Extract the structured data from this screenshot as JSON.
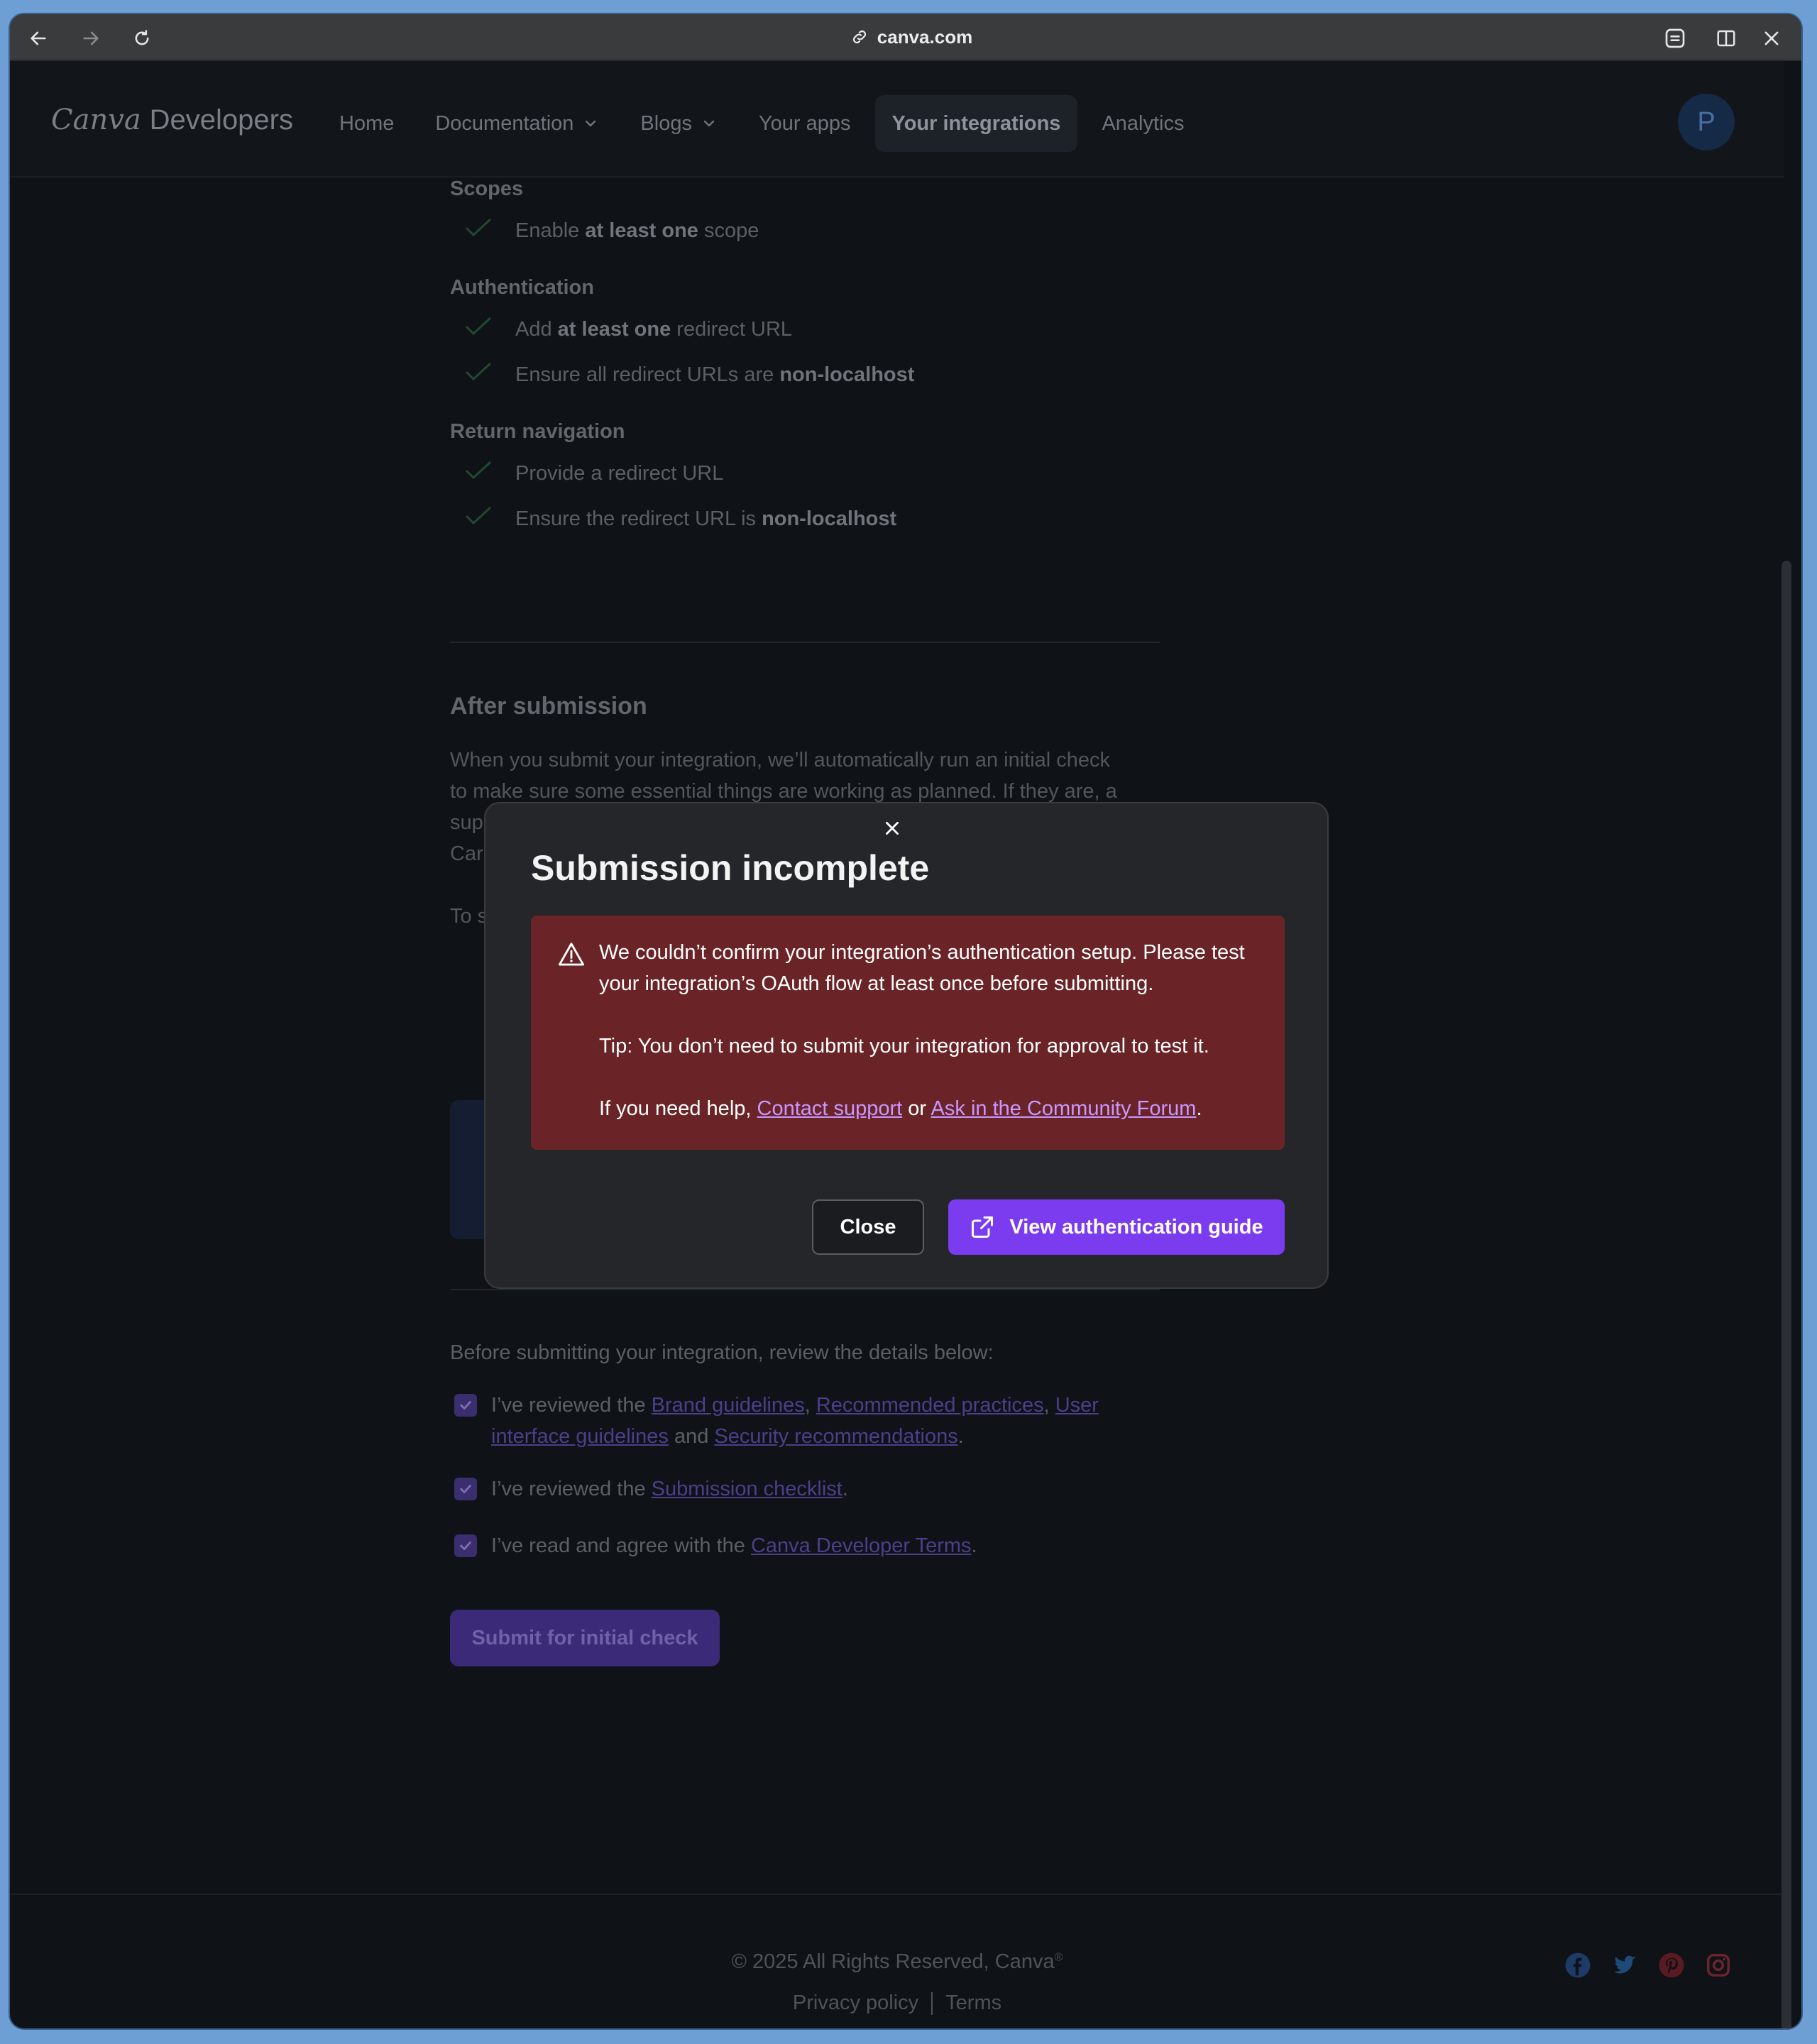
{
  "browser": {
    "url": "canva.com"
  },
  "header": {
    "logo_script": "Canva",
    "logo_text": "Developers",
    "nav": [
      {
        "label": "Home"
      },
      {
        "label": "Documentation"
      },
      {
        "label": "Blogs"
      },
      {
        "label": "Your apps"
      },
      {
        "label": "Your integrations"
      },
      {
        "label": "Analytics"
      }
    ],
    "avatar_initial": "P"
  },
  "checklist": {
    "scopes_title": "Scopes",
    "scopes_item_pre": "Enable ",
    "scopes_item_bold": "at least one",
    "scopes_item_post": " scope",
    "auth_title": "Authentication",
    "auth_item1_pre": "Add ",
    "auth_item1_bold": "at least one",
    "auth_item1_post": " redirect URL",
    "auth_item2_pre": "Ensure all redirect URLs are ",
    "auth_item2_bold": "non-localhost",
    "return_title": "Return navigation",
    "return_item1": "Provide a redirect URL",
    "return_item2_pre": "Ensure the redirect URL is ",
    "return_item2_bold": "non-localhost"
  },
  "after": {
    "title": "After submission",
    "para_line1": "When you submit your integration, we’ll automatically run an initial check",
    "para_line2": "to make sure some essential things are working as planned. If they are, a",
    "para_line3": "sup",
    "para_line4": "Car",
    "para_line5": "To s"
  },
  "review": {
    "intro": "Before submitting your integration, review the details below:",
    "item1_pre": "I’ve reviewed the ",
    "item1_link1": "Brand guidelines",
    "item1_sep1": ", ",
    "item1_link2": "Recommended practices",
    "item1_sep2": ", ",
    "item1_link3a": "User",
    "item1_link3b": "interface guidelines",
    "item1_and": " and ",
    "item1_link4": "Security recommendations",
    "item1_end": ".",
    "item2_pre": "I’ve reviewed the ",
    "item2_link": "Submission checklist",
    "item2_end": ".",
    "item3_pre": "I’ve read and agree with the ",
    "item3_link": "Canva Developer Terms",
    "item3_end": ".",
    "submit_label": "Submit for initial check"
  },
  "footer": {
    "copyright": "© 2025 All Rights Reserved, Canva",
    "copyright_mark": "®",
    "privacy": "Privacy policy",
    "terms": "Terms"
  },
  "modal": {
    "title": "Submission incomplete",
    "message": "We couldn’t confirm your integration’s authentication setup. Please test your integration’s OAuth flow at least once before submitting.",
    "tip": "Tip: You don’t need to submit your integration for approval to test it.",
    "help_pre": "If you need help, ",
    "help_link1": "Contact support",
    "help_or": " or ",
    "help_link2": "Ask in the Community Forum",
    "help_end": ".",
    "close_label": "Close",
    "guide_label": "View authentication guide"
  },
  "colors": {
    "accent": "#7b3cf0",
    "alert_bg": "#6a2427",
    "page_bg": "#0f1216"
  }
}
